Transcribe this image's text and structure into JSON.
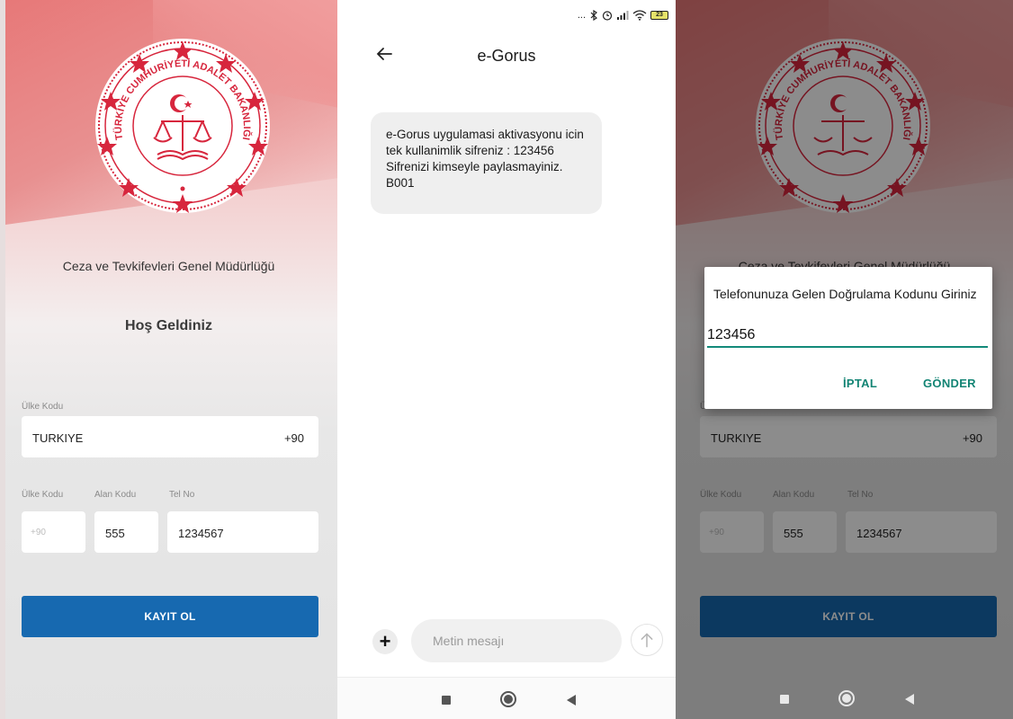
{
  "login": {
    "logo_text": "TÜRKİYE CUMHURİYETİ ADALET BAKANLIĞI",
    "agency": "Ceza ve Tevkifevleri Genel Müdürlüğü",
    "welcome": "Hoş Geldiniz",
    "country_label": "Ülke Kodu",
    "country_name": "TURKIYE",
    "country_dial": "+90",
    "phone_labels": {
      "country": "Ülke Kodu",
      "area": "Alan Kodu",
      "number": "Tel No"
    },
    "phone_country_placeholder": "+90",
    "phone_area": "555",
    "phone_number": "1234567",
    "register_button": "KAYIT OL",
    "colors": {
      "primary": "#1769b0",
      "header_red": "#e77373"
    }
  },
  "sms": {
    "status_icons": [
      "more-icon",
      "bluetooth-icon",
      "alarm-icon",
      "signal-icon",
      "wifi-icon",
      "battery-icon"
    ],
    "status_dots": "...",
    "battery_level": "23",
    "title": "e-Gorus",
    "message": "e-Gorus uygulamasi aktivasyonu icin tek kullanimlik sifreniz : 123456 Sifrenizi kimseyle paylasmayiniz. B001",
    "composer_placeholder": "Metin mesajı",
    "plus_label": "+"
  },
  "dialog": {
    "title": "Telefonunuza Gelen Doğrulama Kodunu Giriniz",
    "code_value": "123456",
    "cancel_label": "İPTAL",
    "send_label": "GÖNDER",
    "accent": "#128474"
  },
  "navbar": {
    "icons": [
      "recent-apps-icon",
      "home-icon",
      "back-icon"
    ]
  }
}
